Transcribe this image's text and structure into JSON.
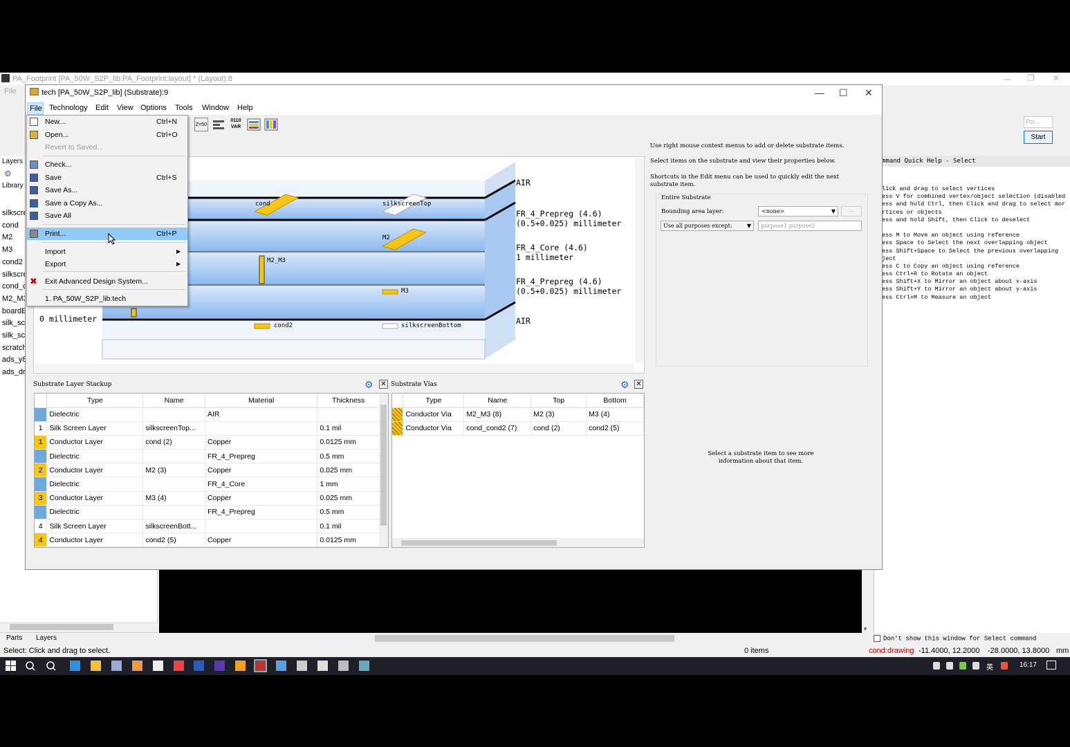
{
  "bg_window": {
    "title": "PA_Footprint [PA_50W_S2P_lib:PA_Footprint:layout] * (Layout):8",
    "menu_file": "File",
    "left_panel": {
      "tab_layers": "Layers",
      "library_label": "Library",
      "items": [
        "silkscre",
        "cond",
        "M2",
        "M3",
        "cond2",
        "silkscre",
        "cond_c",
        "M2_M3",
        "boardE",
        "silk_scr",
        "silk_scr",
        "scratch",
        "ads_y8",
        "ads_dr"
      ],
      "bottom_tabs": [
        "Parts",
        "Layers"
      ]
    },
    "status": {
      "left": "Select: Click and drag to select.",
      "items": "0 items",
      "layer": "cond:drawing",
      "coord1": "-11.4000, 12.2000",
      "coord2": "-28.0000, 13.8000",
      "unit": "mm"
    },
    "right_widgets": {
      "pos_box": "Poi...",
      "start_button": "Start"
    }
  },
  "quick_help": {
    "title": "mmand Quick Help - Select",
    "lines": [
      "lick and drag to select vertices",
      "ess V for combined vertex/object selection (disabled)",
      "ess and hold Ctrl, then Click and drag to select more",
      "rtices or objects",
      "ess and hold Shift, then Click to deselect",
      "",
      "ess M to Move an object using reference",
      "ess Space to Select the next overlapping object",
      "ess Shift+Space to Select the previous overlapping",
      "ject",
      "ess C to Copy an object using reference",
      "ess Ctrl+R to Rotate an object",
      "ess Shift+X to Mirror an object about x-axis",
      "ess Shift+Y to Mirror an object about y-axis",
      "ess Ctrl+M to Measure an object"
    ],
    "dont_show": "Don't show this window for Select command"
  },
  "dialog": {
    "title": "tech [PA_50W_S2P_lib] (Substrate):9",
    "menus": [
      "File",
      "Technology",
      "Edit",
      "View",
      "Options",
      "Tools",
      "Window",
      "Help"
    ],
    "toolbar_labels": [
      "Z=50",
      "0110 VAR"
    ],
    "file_menu": {
      "items": [
        {
          "label": "New...",
          "shortcut": "Ctrl+N"
        },
        {
          "label": "Open...",
          "shortcut": "Ctrl+O"
        },
        {
          "label": "Revert to Saved...",
          "shortcut": ""
        },
        {
          "label": "Check...",
          "shortcut": ""
        },
        {
          "label": "Save",
          "shortcut": "Ctrl+S"
        },
        {
          "label": "Save As...",
          "shortcut": ""
        },
        {
          "label": "Save a Copy As...",
          "shortcut": ""
        },
        {
          "label": "Save All",
          "shortcut": ""
        },
        {
          "label": "Print...",
          "shortcut": "Ctrl+P"
        },
        {
          "label": "Import",
          "shortcut": ""
        },
        {
          "label": "Export",
          "shortcut": ""
        },
        {
          "label": "Exit Advanced Design System...",
          "shortcut": ""
        },
        {
          "label": "1. PA_50W_S2P_lib:tech",
          "shortcut": ""
        }
      ]
    },
    "viewport": {
      "layer_labels": [
        "AIR",
        "FR_4_Prepreg (4.6)",
        "(0.5+0.025) millimeter",
        "FR_4_Core (4.6)",
        "1 millimeter",
        "FR_4_Prepreg (4.6)",
        "(0.5+0.025) millimeter",
        "AIR"
      ],
      "object_labels": [
        "cond",
        "silkscreenTop",
        "M2",
        "M2_M3",
        "M3",
        "cond2",
        "silkscreenBottom"
      ],
      "zero_label": "0 millimeter"
    },
    "info": {
      "line1": "Use right mouse context menus to add or delete substrate items.",
      "line2": "Select items on the substrate and view their properties below.",
      "line3": "Shortcuts in the Edit menu can be used to quickly edit the next substrate item.",
      "group_title": "Entire Substrate",
      "bounding_label": "Bounding area layer:",
      "bounding_value": "<none>",
      "bounding_btn": "...",
      "purpose_select": "Use all purposes except:",
      "purpose_input": "purpose1 purpose2",
      "select_hint": "Select a substrate item to see more information about that item."
    },
    "stackup": {
      "title": "Substrate Layer Stackup",
      "columns": [
        "Type",
        "Name",
        "Material",
        "Thickness"
      ],
      "rows": [
        {
          "idx": "",
          "color": "#6fa8dc",
          "type": "Dielectric",
          "name": "",
          "material": "AIR",
          "thickness": ""
        },
        {
          "idx": "1",
          "color": "#ffffff",
          "type": "Silk Screen Layer",
          "name": "silkscreenTop...",
          "material": "",
          "thickness": "0.1 mil"
        },
        {
          "idx": "1",
          "color": "#f5c518",
          "type": "Conductor Layer",
          "name": "cond (2)",
          "material": "Copper",
          "thickness": "0.0125 mm"
        },
        {
          "idx": "",
          "color": "#6fa8dc",
          "type": "Dielectric",
          "name": "",
          "material": "FR_4_Prepreg",
          "thickness": "0.5 mm"
        },
        {
          "idx": "2",
          "color": "#f5c518",
          "type": "Conductor Layer",
          "name": "M2 (3)",
          "material": "Copper",
          "thickness": "0.025 mm"
        },
        {
          "idx": "",
          "color": "#6fa8dc",
          "type": "Dielectric",
          "name": "",
          "material": "FR_4_Core",
          "thickness": "1 mm"
        },
        {
          "idx": "3",
          "color": "#f5c518",
          "type": "Conductor Layer",
          "name": "M3 (4)",
          "material": "Copper",
          "thickness": "0.025 mm"
        },
        {
          "idx": "",
          "color": "#6fa8dc",
          "type": "Dielectric",
          "name": "",
          "material": "FR_4_Prepreg",
          "thickness": "0.5 mm"
        },
        {
          "idx": "4",
          "color": "#ffffff",
          "type": "Silk Screen Layer",
          "name": "silkscreenBott...",
          "material": "",
          "thickness": "0.1 mil"
        },
        {
          "idx": "4",
          "color": "#f5c518",
          "type": "Conductor Layer",
          "name": "cond2 (5)",
          "material": "Copper",
          "thickness": "0.0125 mm"
        }
      ]
    },
    "vias": {
      "title": "Substrate Vias",
      "columns": [
        "Type",
        "Name",
        "Top",
        "Bottom"
      ],
      "rows": [
        {
          "type": "Conductor Via",
          "name": "M2_M3 (8)",
          "top": "M2 (3)",
          "bottom": "M3 (4)"
        },
        {
          "type": "Conductor Via",
          "name": "cond_cond2 (7)",
          "top": "cond (2)",
          "bottom": "cond2 (5)"
        }
      ]
    }
  },
  "taskbar": {
    "time": "16:17",
    "lang": "英"
  }
}
